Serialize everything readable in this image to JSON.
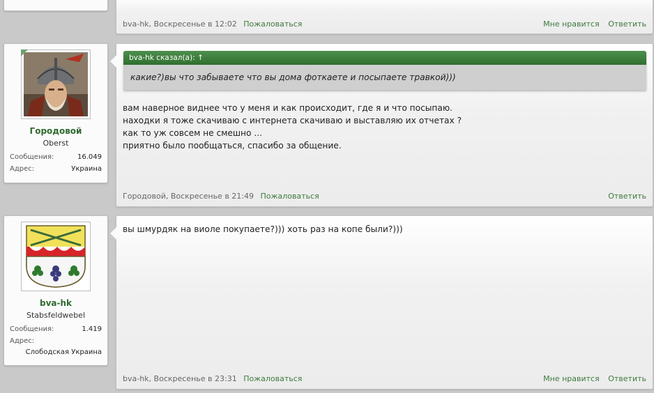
{
  "top_post": {
    "footer_author": "bva-hk, Воскресенье в 12:02",
    "report_label": "Пожаловаться",
    "like_label": "Мне нравится",
    "reply_label": "Ответить"
  },
  "post1": {
    "user": {
      "name": "Городовой",
      "rank": "Oberst",
      "messages_label": "Сообщения:",
      "messages_value": "16.049",
      "address_label": "Адрес:",
      "address_value": "Украина"
    },
    "quote": {
      "header": "bva-hk сказал(а): ↑",
      "text": "какие?)вы что забываете что вы дома фоткаете и посыпаете травкой)))"
    },
    "body": "вам наверное виднее что у меня и как происходит, где я и что посыпаю.\nнаходки я тоже скачиваю с интернета скачиваю и выставляю их отчетах ?\nкак то уж совсем не смешно ...\nприятно было пообщаться, спасибо за общение.",
    "footer_author": "Городовой, Воскресенье в 21:49",
    "report_label": "Пожаловаться",
    "reply_label": "Ответить"
  },
  "post2": {
    "user": {
      "name": "bva-hk",
      "rank": "Stabsfeldwebel",
      "messages_label": "Сообщения:",
      "messages_value": "1.419",
      "address_label": "Адрес:",
      "address_value": "Слободская Украина"
    },
    "body": "вы шмурдяк на виоле покупаете?))) хоть раз на копе были?)))",
    "footer_author": "bva-hk, Воскресенье в 23:31",
    "report_label": "Пожаловаться",
    "like_label": "Мне нравится",
    "reply_label": "Ответить"
  }
}
